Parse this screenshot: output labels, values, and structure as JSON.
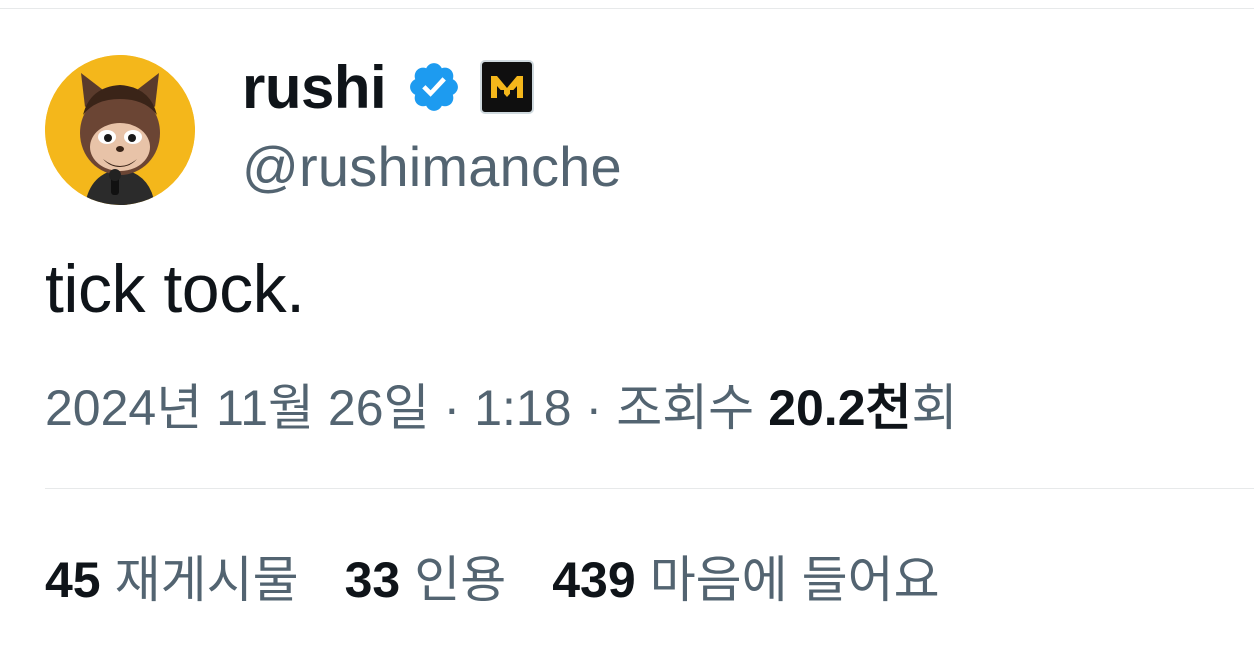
{
  "user": {
    "display_name": "rushi",
    "handle": "@rushimanche",
    "verified_icon": "verified-checkmark-icon",
    "affiliate_badge_icon": "affiliate-m-badge-icon",
    "avatar_icon": "cartoon-cat-avatar",
    "colors": {
      "verified": "#1d9bf0",
      "avatar_bg": "#f4b71b",
      "badge_bg": "#0f0f0f",
      "badge_fg": "#f4b71b"
    }
  },
  "tweet": {
    "text": "tick tock.",
    "date": "2024년 11월 26일",
    "time": "1:18",
    "separator": "·",
    "views_label": "조회수",
    "views_count": "20.2천",
    "views_suffix": "회"
  },
  "stats": {
    "reposts": {
      "count": "45",
      "label": "재게시물"
    },
    "quotes": {
      "count": "33",
      "label": "인용"
    },
    "likes": {
      "count": "439",
      "label": "마음에 들어요"
    }
  },
  "colors": {
    "text_primary": "#0f1419",
    "text_secondary": "#536471",
    "divider": "#e7e9ea"
  }
}
